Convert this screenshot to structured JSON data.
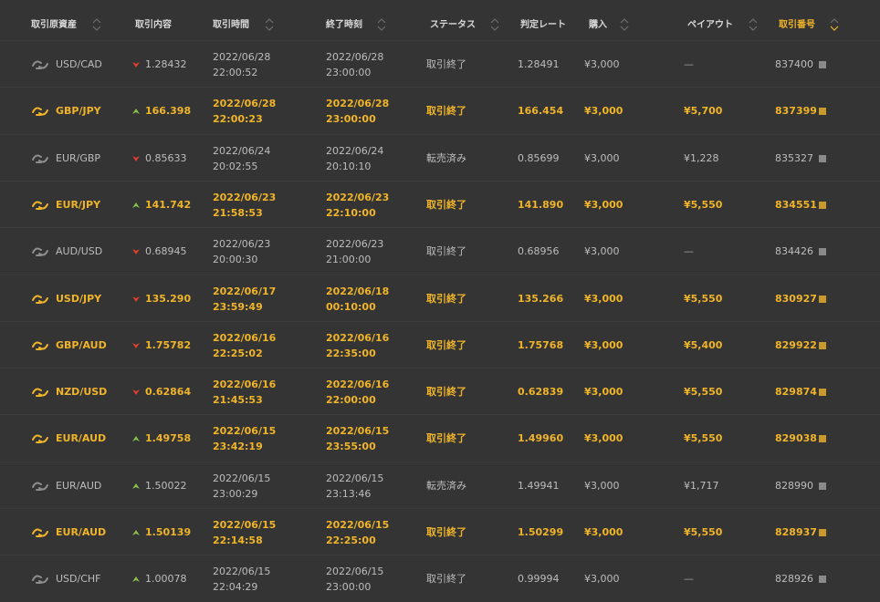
{
  "columns": [
    {
      "label": "取引原資産",
      "active": false
    },
    {
      "label": "取引内容",
      "active": false
    },
    {
      "label": "取引時間",
      "active": false
    },
    {
      "label": "終了時刻",
      "active": false
    },
    {
      "label": "ステータス",
      "active": false
    },
    {
      "label": "判定レート",
      "active": false
    },
    {
      "label": "購入",
      "active": false
    },
    {
      "label": "ペイアウト",
      "active": false
    },
    {
      "label": "取引番号",
      "active": true
    }
  ],
  "colors": {
    "accent": "#f0b429",
    "down": "#e2402c",
    "up": "#8bc34a"
  },
  "rows": [
    {
      "asset": "USD/CAD",
      "direction": "down",
      "entry": "1.28432",
      "start_date": "2022/06/28",
      "start_time": "22:00:52",
      "end_date": "2022/06/28",
      "end_time": "23:00:00",
      "status": "取引終了",
      "rate": "1.28491",
      "amount": "¥3,000",
      "payout": "—",
      "id": "837400",
      "win": false
    },
    {
      "asset": "GBP/JPY",
      "direction": "up",
      "entry": "166.398",
      "start_date": "2022/06/28",
      "start_time": "22:00:23",
      "end_date": "2022/06/28",
      "end_time": "23:00:00",
      "status": "取引終了",
      "rate": "166.454",
      "amount": "¥3,000",
      "payout": "¥5,700",
      "id": "837399",
      "win": true
    },
    {
      "asset": "EUR/GBP",
      "direction": "down",
      "entry": "0.85633",
      "start_date": "2022/06/24",
      "start_time": "20:02:55",
      "end_date": "2022/06/24",
      "end_time": "20:10:10",
      "status": "転売済み",
      "rate": "0.85699",
      "amount": "¥3,000",
      "payout": "¥1,228",
      "id": "835327",
      "win": false
    },
    {
      "asset": "EUR/JPY",
      "direction": "up",
      "entry": "141.742",
      "start_date": "2022/06/23",
      "start_time": "21:58:53",
      "end_date": "2022/06/23",
      "end_time": "22:10:00",
      "status": "取引終了",
      "rate": "141.890",
      "amount": "¥3,000",
      "payout": "¥5,550",
      "id": "834551",
      "win": true
    },
    {
      "asset": "AUD/USD",
      "direction": "down",
      "entry": "0.68945",
      "start_date": "2022/06/23",
      "start_time": "20:00:30",
      "end_date": "2022/06/23",
      "end_time": "21:00:00",
      "status": "取引終了",
      "rate": "0.68956",
      "amount": "¥3,000",
      "payout": "—",
      "id": "834426",
      "win": false
    },
    {
      "asset": "USD/JPY",
      "direction": "down",
      "entry": "135.290",
      "start_date": "2022/06/17",
      "start_time": "23:59:49",
      "end_date": "2022/06/18",
      "end_time": "00:10:00",
      "status": "取引終了",
      "rate": "135.266",
      "amount": "¥3,000",
      "payout": "¥5,550",
      "id": "830927",
      "win": true
    },
    {
      "asset": "GBP/AUD",
      "direction": "down",
      "entry": "1.75782",
      "start_date": "2022/06/16",
      "start_time": "22:25:02",
      "end_date": "2022/06/16",
      "end_time": "22:35:00",
      "status": "取引終了",
      "rate": "1.75768",
      "amount": "¥3,000",
      "payout": "¥5,400",
      "id": "829922",
      "win": true
    },
    {
      "asset": "NZD/USD",
      "direction": "down",
      "entry": "0.62864",
      "start_date": "2022/06/16",
      "start_time": "21:45:53",
      "end_date": "2022/06/16",
      "end_time": "22:00:00",
      "status": "取引終了",
      "rate": "0.62839",
      "amount": "¥3,000",
      "payout": "¥5,550",
      "id": "829874",
      "win": true
    },
    {
      "asset": "EUR/AUD",
      "direction": "up",
      "entry": "1.49758",
      "start_date": "2022/06/15",
      "start_time": "23:42:19",
      "end_date": "2022/06/15",
      "end_time": "23:55:00",
      "status": "取引終了",
      "rate": "1.49960",
      "amount": "¥3,000",
      "payout": "¥5,550",
      "id": "829038",
      "win": true
    },
    {
      "asset": "EUR/AUD",
      "direction": "up",
      "entry": "1.50022",
      "start_date": "2022/06/15",
      "start_time": "23:00:29",
      "end_date": "2022/06/15",
      "end_time": "23:13:46",
      "status": "転売済み",
      "rate": "1.49941",
      "amount": "¥3,000",
      "payout": "¥1,717",
      "id": "828990",
      "win": false
    },
    {
      "asset": "EUR/AUD",
      "direction": "up",
      "entry": "1.50139",
      "start_date": "2022/06/15",
      "start_time": "22:14:58",
      "end_date": "2022/06/15",
      "end_time": "22:25:00",
      "status": "取引終了",
      "rate": "1.50299",
      "amount": "¥3,000",
      "payout": "¥5,550",
      "id": "828937",
      "win": true
    },
    {
      "asset": "USD/CHF",
      "direction": "up",
      "entry": "1.00078",
      "start_date": "2022/06/15",
      "start_time": "22:04:29",
      "end_date": "2022/06/15",
      "end_time": "23:00:00",
      "status": "取引終了",
      "rate": "0.99994",
      "amount": "¥3,000",
      "payout": "—",
      "id": "828926",
      "win": false
    }
  ]
}
